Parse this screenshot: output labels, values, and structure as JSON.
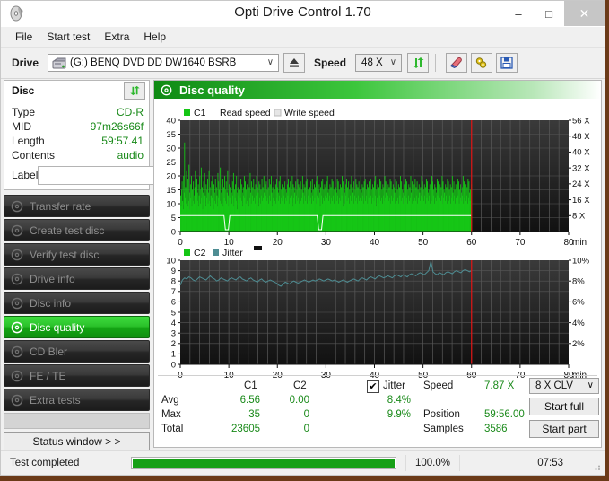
{
  "window": {
    "title": "Opti Drive Control 1.70",
    "icon": "disc-icon",
    "minimize": "–",
    "maximize": "□",
    "close": "✕"
  },
  "menu": {
    "items": [
      "File",
      "Start test",
      "Extra",
      "Help"
    ]
  },
  "toolbar": {
    "drive_label": "Drive",
    "drive_value": "(G:)  BENQ DVD DD DW1640 BSRB",
    "speed_label": "Speed",
    "speed_value": "48 X",
    "caret": "∨",
    "buttons": [
      {
        "name": "refresh-drive-button",
        "icon": "refresh-arrows-icon"
      },
      {
        "name": "erase-button",
        "icon": "eraser-icon"
      },
      {
        "name": "bitsetting-button",
        "icon": "plug-icon"
      },
      {
        "name": "save-button",
        "icon": "floppy-disk-icon"
      }
    ]
  },
  "disc_panel": {
    "header": "Disc",
    "refresh_icon": "refresh-arrows-icon",
    "rows": [
      {
        "key": "Type",
        "value": "CD-R"
      },
      {
        "key": "MID",
        "value": "97m26s66f"
      },
      {
        "key": "Length",
        "value": "59:57.41"
      },
      {
        "key": "Contents",
        "value": "audio"
      }
    ],
    "label_key": "Label",
    "label_value": "",
    "label_placeholder": "",
    "cd_icon": "cd-disc-icon"
  },
  "nav": {
    "items": [
      {
        "label": "Transfer rate",
        "icon": "disc-icon",
        "active": false
      },
      {
        "label": "Create test disc",
        "icon": "disc-icon",
        "active": false
      },
      {
        "label": "Verify test disc",
        "icon": "disc-icon",
        "active": false
      },
      {
        "label": "Drive info",
        "icon": "disc-icon",
        "active": false
      },
      {
        "label": "Disc info",
        "icon": "disc-icon",
        "active": false
      },
      {
        "label": "Disc quality",
        "icon": "disc-icon",
        "active": true
      },
      {
        "label": "CD Bler",
        "icon": "disc-icon",
        "active": false
      },
      {
        "label": "FE / TE",
        "icon": "disc-icon",
        "active": false
      },
      {
        "label": "Extra tests",
        "icon": "disc-icon",
        "active": false
      }
    ],
    "status_window": "Status window > >"
  },
  "panel": {
    "title": "Disc quality",
    "icon": "disc-quality-icon"
  },
  "chart_data": [
    {
      "type": "bar",
      "title": "Disc quality",
      "legend": [
        {
          "label": "C1",
          "color": "#16c616",
          "swatch": "square"
        },
        {
          "label": "Read speed",
          "color": "#ffffff",
          "swatch": "none"
        },
        {
          "label": "Write speed",
          "color": "#e6e6e6",
          "swatch": "square"
        }
      ],
      "xlabel": "min",
      "xlim": [
        0,
        80
      ],
      "xticks": [
        0,
        10,
        20,
        30,
        40,
        50,
        60,
        70,
        80
      ],
      "ylabel_left": "C1",
      "ylim_left": [
        0,
        40
      ],
      "yticks_left": [
        0,
        5,
        10,
        15,
        20,
        25,
        30,
        35,
        40
      ],
      "ylabel_right": "speed",
      "ylim_right": [
        0,
        56
      ],
      "yticks_right": [
        "8 X",
        "16 X",
        "24 X",
        "32 X",
        "40 X",
        "48 X",
        "56 X"
      ],
      "grid": true,
      "background": "#2b2b2b",
      "marker_line_x": 60,
      "marker_line_color": "#e01414",
      "data_end_x": 60,
      "series": [
        {
          "name": "C1",
          "color": "#16c616",
          "x_start": 0,
          "x_end": 60,
          "values": [
            13,
            9,
            15,
            18,
            11,
            8,
            20,
            14,
            32,
            12,
            16,
            10,
            22,
            13,
            9,
            19,
            11,
            24,
            14,
            8,
            17,
            12,
            20,
            9,
            15,
            11,
            18,
            13,
            10,
            16,
            22,
            12,
            8,
            19,
            14,
            11,
            17,
            9,
            13,
            20,
            15,
            10,
            23,
            12,
            16,
            8,
            14,
            18,
            11,
            21,
            13,
            9,
            17,
            12,
            15,
            19,
            10,
            14,
            22,
            11,
            16,
            9,
            13,
            18,
            12,
            20,
            15,
            8,
            17,
            11,
            14,
            19,
            10,
            16,
            13,
            9,
            21,
            12,
            18,
            15,
            11,
            23,
            14,
            10,
            17,
            13,
            19,
            9,
            16,
            12,
            20,
            11,
            15,
            18,
            10,
            14,
            22,
            13,
            9,
            17,
            12,
            16,
            11,
            19,
            14,
            10,
            18,
            13,
            21,
            9,
            15,
            12,
            17,
            11,
            20,
            14,
            8,
            16,
            13,
            18,
            10,
            15,
            12,
            19,
            11,
            17,
            14,
            9,
            16,
            13,
            20,
            12,
            18,
            10,
            15,
            11,
            17,
            13,
            19,
            9,
            16,
            12,
            21,
            14,
            10,
            18,
            13,
            16,
            11,
            19,
            12,
            15,
            10,
            17,
            13,
            20,
            11,
            16,
            14,
            9,
            18,
            12,
            17,
            10,
            15,
            13,
            19,
            11,
            16,
            12,
            20,
            14,
            10,
            17,
            13,
            18,
            11,
            15,
            12,
            16,
            10,
            19,
            13,
            17,
            11,
            20,
            14,
            9,
            16,
            12,
            18,
            13,
            15,
            11,
            17,
            10,
            19,
            12,
            16,
            14,
            11,
            18,
            13,
            20,
            10,
            15,
            12,
            17,
            11,
            19,
            13,
            16,
            10,
            18,
            12,
            15,
            14,
            11,
            17,
            13,
            19,
            10,
            16,
            12,
            18,
            11,
            15,
            13,
            20,
            9,
            17,
            12,
            16,
            14,
            10,
            18,
            13,
            15,
            11,
            19,
            12,
            17,
            10,
            16,
            13,
            18,
            11,
            15,
            12,
            20,
            14,
            10,
            17,
            13,
            16,
            11,
            18,
            12,
            19,
            10,
            15,
            13,
            17,
            11,
            16,
            12,
            18,
            14,
            10,
            19,
            13,
            15,
            11,
            17,
            12,
            16,
            10,
            18,
            13,
            20,
            11,
            15,
            12,
            17,
            14,
            9,
            16,
            13,
            18,
            10,
            19,
            12,
            15,
            11,
            17,
            13,
            16,
            10,
            18,
            12,
            20,
            14,
            11,
            15,
            13,
            17,
            10,
            16,
            12,
            19,
            11,
            18,
            13,
            15,
            10,
            17,
            12,
            16,
            14,
            11,
            19,
            13,
            18,
            10,
            15,
            12,
            17,
            11,
            16,
            13,
            20,
            9,
            18,
            12,
            15,
            14,
            10,
            17,
            13,
            19,
            11,
            16,
            12,
            18,
            10,
            15,
            13,
            17,
            11,
            20,
            12,
            16,
            14,
            10,
            18,
            13,
            15,
            11,
            19,
            12,
            17,
            10,
            16,
            13,
            18,
            11,
            15,
            12,
            20,
            14,
            11,
            17,
            13,
            16,
            10,
            18,
            12,
            19,
            11,
            15,
            13,
            17,
            10,
            16,
            12,
            18,
            14,
            11,
            19,
            13,
            15,
            10,
            17,
            12,
            16,
            11,
            18,
            13,
            20,
            9,
            15,
            12,
            17,
            14,
            10,
            16,
            13,
            19,
            11,
            18,
            12,
            15,
            10,
            17,
            13,
            16,
            11,
            20,
            12,
            18,
            14,
            10,
            15,
            13,
            17,
            11,
            16,
            12,
            19,
            10,
            18,
            13,
            15,
            11,
            17,
            12,
            16,
            14,
            10,
            19,
            13,
            18,
            11,
            15,
            12,
            17,
            10,
            16,
            13,
            20,
            11,
            18,
            12,
            15,
            14,
            10,
            17,
            13,
            16,
            11,
            19,
            12,
            18,
            10,
            15,
            13,
            17,
            11,
            16,
            12,
            20,
            14,
            10,
            18,
            13,
            15,
            11,
            17,
            12,
            19,
            11,
            16,
            13,
            18,
            10,
            15,
            12,
            17,
            14,
            11,
            16,
            13,
            20,
            10,
            18,
            12,
            15,
            11,
            17,
            13,
            16,
            10,
            19,
            12,
            18,
            14,
            11,
            15,
            13,
            17,
            10,
            16,
            12,
            20,
            11,
            18,
            13,
            15,
            10,
            17,
            12,
            16,
            14,
            11,
            19,
            13,
            18,
            10,
            15,
            12,
            17,
            11,
            16,
            13,
            20,
            10,
            18,
            12,
            15,
            14,
            11,
            17,
            13,
            16,
            10,
            19,
            12,
            18,
            11,
            15,
            13,
            17,
            10,
            16,
            12,
            20,
            14,
            11,
            18,
            13,
            15,
            10,
            17,
            12,
            16,
            11,
            19,
            13,
            18,
            10,
            15,
            12,
            17,
            14,
            11,
            16,
            13,
            20,
            10,
            18,
            12,
            15,
            11,
            17,
            13,
            16,
            10,
            19,
            12,
            18,
            14,
            11,
            15,
            13,
            17
          ]
        },
        {
          "name": "Read speed",
          "color": "#ffffff",
          "type": "line",
          "x_start": 0,
          "x_end": 60,
          "nominal_x": 8,
          "value_axis": "right",
          "description": "flat white 8X CLV read-speed trace with two brief dips"
        }
      ]
    },
    {
      "type": "line",
      "legend": [
        {
          "label": "C2",
          "color": "#16c616",
          "swatch": "square"
        },
        {
          "label": "Jitter",
          "color": "#4e8d93",
          "swatch": "square"
        }
      ],
      "xlabel": "min",
      "xlim": [
        0,
        80
      ],
      "xticks": [
        0,
        10,
        20,
        30,
        40,
        50,
        60,
        70,
        80
      ],
      "ylim_left": [
        0,
        10
      ],
      "yticks_left": [
        0,
        1,
        2,
        3,
        4,
        5,
        6,
        7,
        8,
        9,
        10
      ],
      "ylim_right": [
        0,
        10
      ],
      "yticks_right": [
        "2%",
        "4%",
        "6%",
        "8%",
        "10%"
      ],
      "grid": true,
      "background": "#2b2b2b",
      "marker_line_x": 60,
      "marker_line_color": "#e01414",
      "data_end_x": 60,
      "series": [
        {
          "name": "Jitter",
          "color": "#4e8d93",
          "unit": "%",
          "values": [
            7.6,
            8.1,
            8.3,
            8.2,
            8.4,
            8.3,
            8.1,
            8.0,
            8.2,
            8.4,
            8.3,
            8.2,
            8.1,
            8.3,
            8.5,
            8.3,
            8.2,
            8.0,
            8.1,
            8.3,
            8.2,
            8.1,
            8.0,
            8.2,
            8.3,
            8.2,
            8.1,
            8.3,
            8.4,
            8.2,
            8.1,
            8.0,
            8.2,
            8.3,
            8.1,
            8.0,
            7.9,
            8.1,
            8.2,
            8.0,
            7.9,
            8.0,
            8.1,
            8.0,
            7.9,
            7.8,
            7.6,
            7.5,
            7.7,
            7.9,
            7.8,
            7.7,
            7.9,
            8.0,
            7.9,
            7.8,
            7.9,
            8.0,
            8.1,
            8.0,
            7.9,
            8.0,
            8.1,
            8.0,
            8.1,
            8.2,
            8.1,
            8.0,
            8.1,
            8.2,
            8.1,
            8.0,
            8.1,
            8.0,
            7.9,
            8.0,
            8.1,
            8.0,
            7.9,
            8.0,
            8.1,
            8.2,
            8.1,
            8.0,
            8.2,
            8.3,
            8.2,
            8.1,
            8.3,
            8.4,
            8.3,
            8.2,
            8.4,
            8.5,
            8.4,
            8.3,
            8.4,
            8.5,
            8.4,
            8.3,
            8.5,
            8.6,
            8.5,
            8.4,
            8.6,
            8.5,
            8.4,
            8.6,
            8.7,
            8.6,
            8.5,
            8.7,
            8.8,
            8.7,
            8.6,
            8.8,
            9.0,
            9.9,
            8.9,
            8.7,
            8.6,
            8.8,
            8.7,
            8.6,
            8.8,
            8.9,
            8.8,
            8.7,
            8.9,
            9.0,
            8.9,
            8.8,
            9.0,
            9.1,
            9.0,
            8.9,
            9.0
          ]
        },
        {
          "name": "C2",
          "color": "#16c616",
          "values_all_zero": true
        }
      ]
    }
  ],
  "stats": {
    "col_headers": [
      "C1",
      "C2"
    ],
    "row_labels": [
      "Avg",
      "Max",
      "Total"
    ],
    "c1": {
      "avg": "6.56",
      "max": "35",
      "total": "23605"
    },
    "c2": {
      "avg": "0.00",
      "max": "0",
      "total": "0"
    },
    "jitter": {
      "checkbox_label": "Jitter",
      "checked": true,
      "check_glyph": "✔",
      "avg": "8.4%",
      "max": "9.9%"
    },
    "info": [
      {
        "key": "Speed",
        "value": "7.87 X"
      },
      {
        "key": "Position",
        "value": "59:56.00"
      },
      {
        "key": "Samples",
        "value": "3586"
      }
    ],
    "speed_select": "8 X CLV",
    "caret": "∨",
    "start_full": "Start full",
    "start_part": "Start part"
  },
  "statusbar": {
    "message": "Test completed",
    "progress_percent": "100.0%",
    "progress_value": 100,
    "elapsed": "07:53"
  }
}
